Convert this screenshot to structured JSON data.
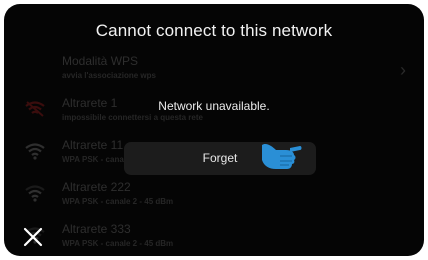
{
  "dialog": {
    "title": "Cannot connect to this network",
    "message": "Network unavailable.",
    "forget_label": "Forget"
  },
  "networks": [
    {
      "name": "Modalità WPS",
      "detail": "avvia l'associazione wps",
      "icon": "chevron-right-icon"
    },
    {
      "name": "Altrarete 1",
      "detail": "impossibile connettersi a questa rete",
      "icon": "wifi-error-icon"
    },
    {
      "name": "Altrarete 11",
      "detail": "WPA PSK - canale",
      "icon": "wifi-full-icon"
    },
    {
      "name": "Altrarete 222",
      "detail": "WPA PSK - canale 2 - 45 dBm",
      "icon": "wifi-medium-icon"
    },
    {
      "name": "Altrarete 333",
      "detail": "WPA PSK - canale 2 - 45 dBm",
      "icon": "wifi-low-icon"
    }
  ],
  "colors": {
    "background": "#050505",
    "dim_text": "#2e2e2e",
    "error_icon": "#3a0d0d",
    "hand_icon": "#2a8fd6"
  }
}
